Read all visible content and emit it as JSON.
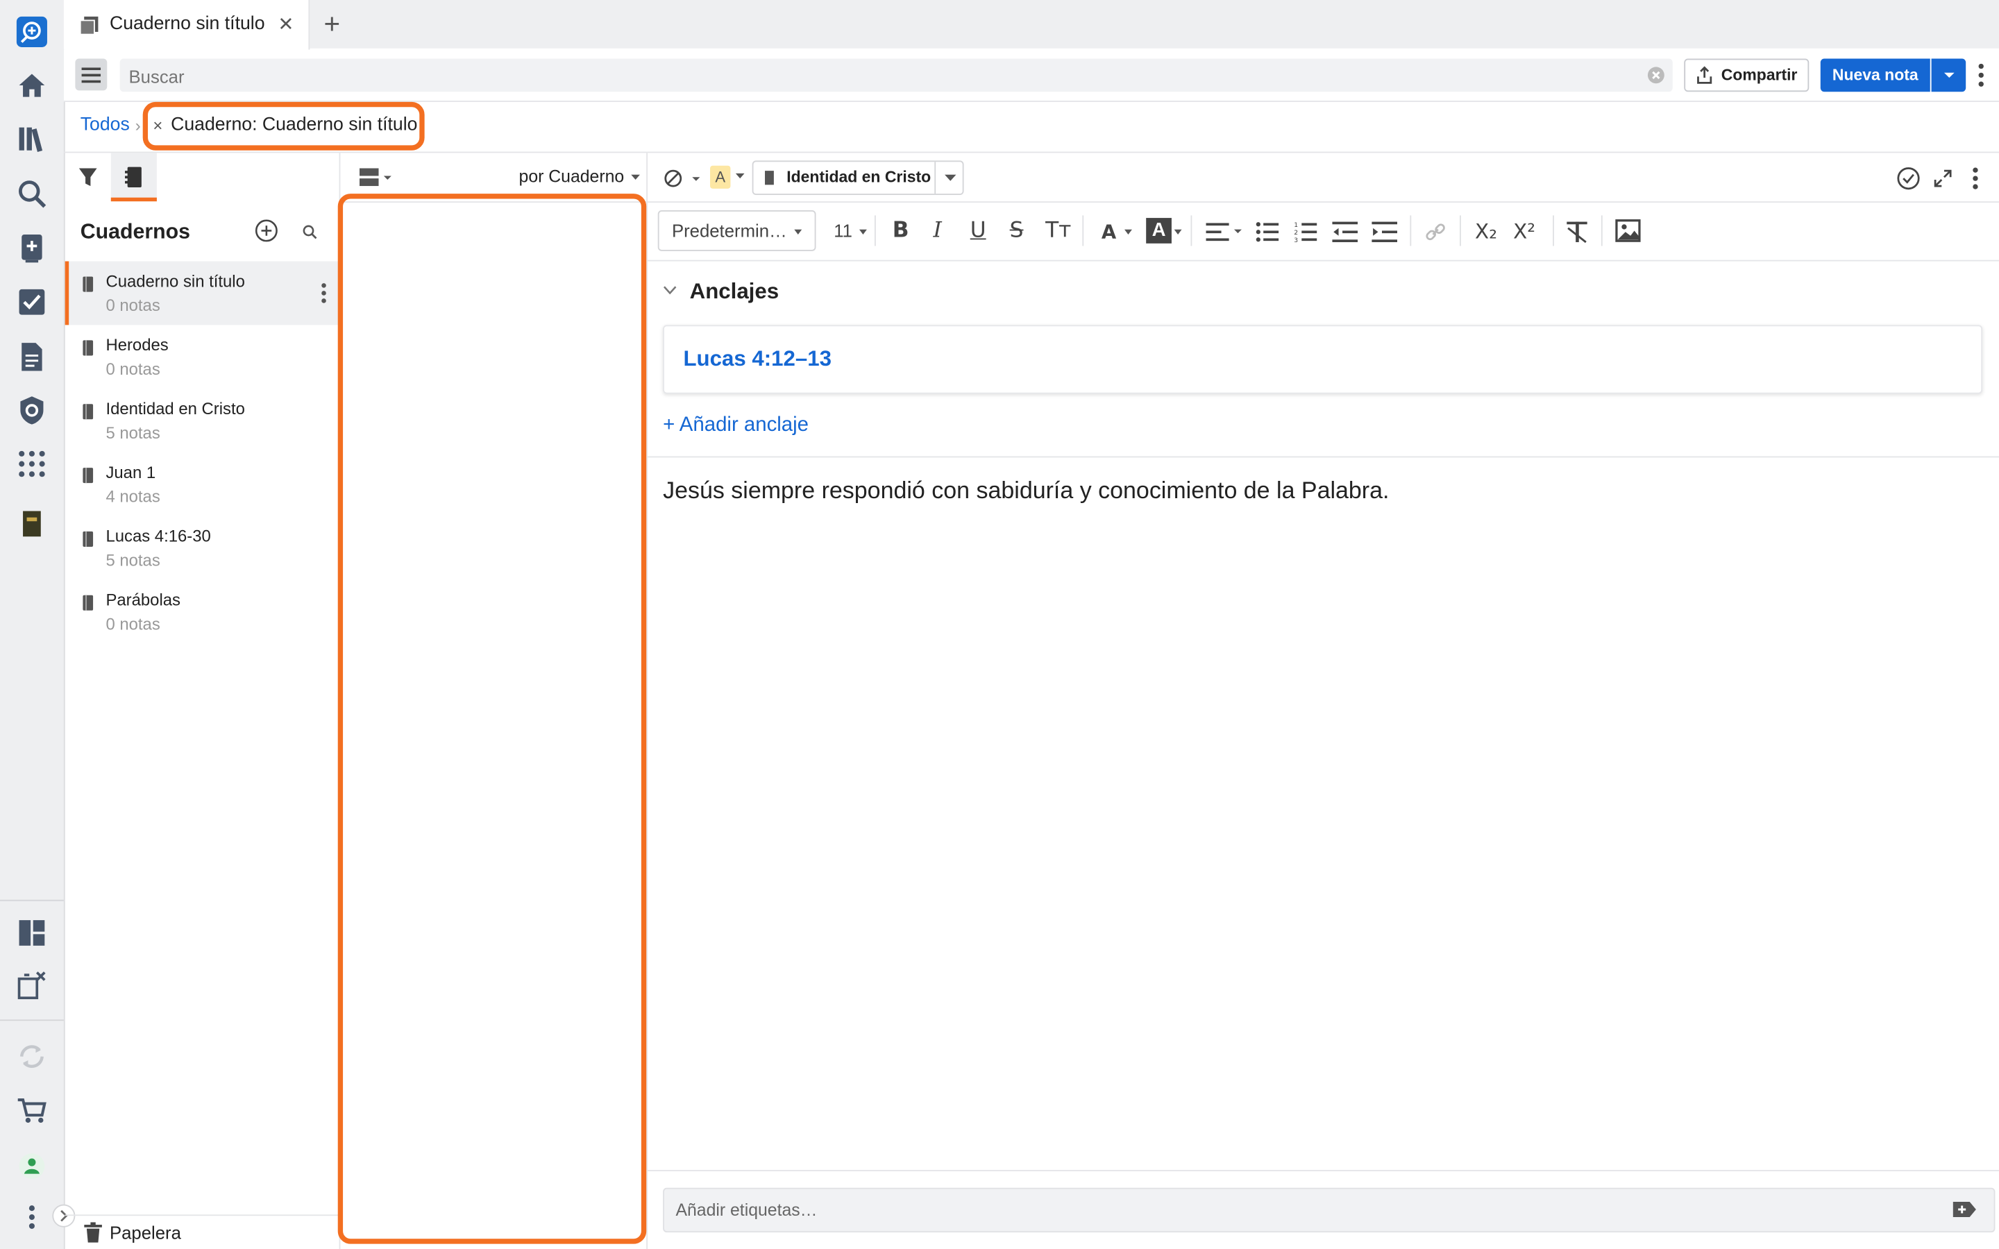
{
  "tab": {
    "title": "Cuaderno sin título",
    "close": "✕",
    "new": "+"
  },
  "toolbar": {
    "search_placeholder": "Buscar",
    "share_label": "Compartir",
    "new_note_label": "Nueva nota"
  },
  "breadcrumb": {
    "root": "Todos",
    "separator": "›",
    "filter_close": "×",
    "filter_label": "Cuaderno: Cuaderno sin título"
  },
  "sidebar": {
    "title": "Cuadernos",
    "notebooks": [
      {
        "name": "Cuaderno sin título",
        "count": "0 notas",
        "selected": true
      },
      {
        "name": "Herodes",
        "count": "0 notas"
      },
      {
        "name": "Identidad en Cristo",
        "count": "5 notas"
      },
      {
        "name": "Juan 1",
        "count": "4 notas"
      },
      {
        "name": "Lucas 4:16-30",
        "count": "5 notas"
      },
      {
        "name": "Parábolas",
        "count": "0 notas"
      }
    ],
    "trash_label": "Papelera"
  },
  "middle": {
    "sort_label": "por Cuaderno"
  },
  "editor": {
    "notebook_label": "Identidad en Cristo",
    "highlight_letter": "A",
    "font_select": "Predetermin…",
    "font_size": "11",
    "anchors_title": "Anclajes",
    "anchor_ref": "Lucas 4:12–13",
    "add_anchor": "+ Añadir anclaje",
    "body_text": "Jesús siempre respondió con sabiduría y conocimiento de la Palabra.",
    "tags_placeholder": "Añadir etiquetas…"
  },
  "format_toolbar": {
    "bold": "B",
    "italic": "I",
    "underline": "U",
    "strike": "S",
    "tt": "Tт",
    "text_color": "A",
    "bg_color": "A",
    "subscript": "X₂",
    "superscript": "X²"
  },
  "colors": {
    "accent": "#1567d3",
    "highlight": "#f36f21",
    "rail_bg": "#eeeff1"
  }
}
